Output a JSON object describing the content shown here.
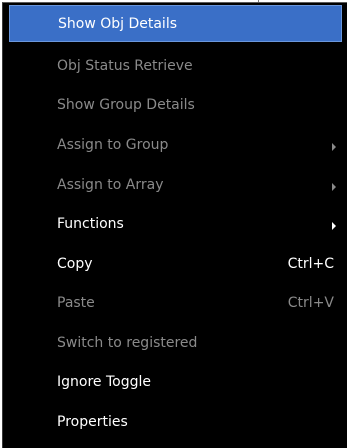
{
  "context_menu": {
    "items": [
      {
        "label": "Show Obj Details",
        "state": "highlighted",
        "shortcut": "",
        "submenu": false
      },
      {
        "label": "Obj Status Retrieve",
        "state": "disabled",
        "shortcut": "",
        "submenu": false
      },
      {
        "label": "Show Group Details",
        "state": "disabled",
        "shortcut": "",
        "submenu": false
      },
      {
        "label": "Assign to Group",
        "state": "disabled",
        "shortcut": "",
        "submenu": true
      },
      {
        "label": "Assign to Array",
        "state": "disabled",
        "shortcut": "",
        "submenu": true
      },
      {
        "label": "Functions",
        "state": "enabled",
        "shortcut": "",
        "submenu": true
      },
      {
        "label": "Copy",
        "state": "enabled",
        "shortcut": "Ctrl+C",
        "submenu": false
      },
      {
        "label": "Paste",
        "state": "disabled",
        "shortcut": "Ctrl+V",
        "submenu": false
      },
      {
        "label": "Switch to registered",
        "state": "disabled",
        "shortcut": "",
        "submenu": false
      },
      {
        "label": "Ignore Toggle",
        "state": "enabled",
        "shortcut": "",
        "submenu": false
      },
      {
        "label": "Properties",
        "state": "enabled",
        "shortcut": "",
        "submenu": false
      }
    ]
  },
  "colors": {
    "menu_background": "#000000",
    "highlight": "#3a6fc7",
    "enabled_text": "#ffffff",
    "disabled_text": "#8a8a8a"
  },
  "icons": {
    "submenu_arrow": "submenu-arrow-icon"
  }
}
